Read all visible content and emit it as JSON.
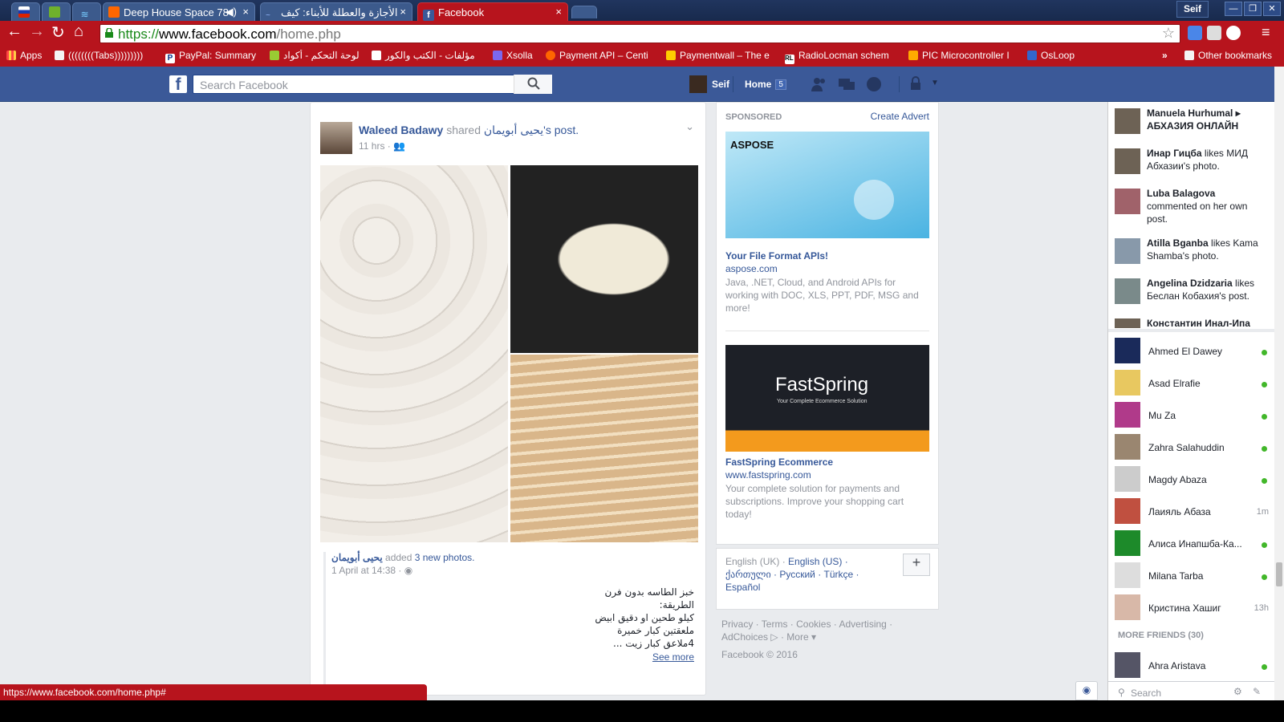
{
  "browser": {
    "tabs": [
      {
        "label": "Deep House Space 78",
        "x": "×"
      },
      {
        "label": "الأجازة والعطلة للأبناء: كيف",
        "x": "×"
      },
      {
        "label": "Facebook",
        "x": "×"
      }
    ],
    "profile": "Seif",
    "url": {
      "scheme": "https://",
      "host": "www.facebook.com",
      "path": "/home.php"
    },
    "bookmarks": [
      "Apps",
      "((((((((Tabs)))))))))",
      "PayPal: Summary",
      "لوحة التحكم - أكواد",
      "مؤلفات - الكتب والكور",
      "Xsolla",
      "Payment API – Centi",
      "Paymentwall – The e",
      "RadioLocman schem",
      "PIC Microcontroller I",
      "OsLoop",
      "»",
      "Other bookmarks"
    ],
    "status_url": "https://www.facebook.com/home.php#"
  },
  "fb_header": {
    "search_placeholder": "Search Facebook",
    "user": "Seif",
    "home": "Home",
    "home_count": "5"
  },
  "post": {
    "author": "Waleed Badawy",
    "shared": "shared",
    "owner": "يحيى أبويمان's",
    "post_word": "post.",
    "time": "11 hrs ·",
    "inner_author": "يحيى أبويمان",
    "inner_added": "added",
    "inner_photos": "3 new photos.",
    "inner_time": "1 April at 14:38 ·",
    "body_lines": [
      "خبز الطاسه بدون فرن",
      "الطريقة:",
      "كيلو طحين او دقيق ابيض",
      "ملعقتين كبار خميرة",
      "4ملاعق كبار زيت ..."
    ],
    "see_more": "See more"
  },
  "ads": {
    "sponsored": "SPONSORED",
    "create": "Create Advert",
    "ad1": {
      "brand": "ASPOSE",
      "title": "Your File Format APIs!",
      "domain": "aspose.com",
      "desc": "Java, .NET, Cloud, and Android APIs for working with DOC, XLS, PPT, PDF, MSG and more!"
    },
    "ad2": {
      "brand": "FastSpring",
      "tagline": "Your Complete Ecommerce Solution",
      "title": "FastSpring Ecommerce",
      "domain": "www.fastspring.com",
      "desc": "Your complete solution for payments and subscriptions. Improve your shopping cart today!"
    }
  },
  "languages": {
    "current": "English (UK) ·",
    "others": [
      "English (US) ·",
      "ქართული ·",
      "Русский ·",
      "Türkçe ·",
      "Español"
    ],
    "plus": "+"
  },
  "footer": {
    "links": "Privacy · Terms · Cookies · Advertising ·",
    "adchoices": "AdChoices",
    "more": "· More ▾",
    "copyright": "Facebook © 2016"
  },
  "ticker": [
    {
      "name": "Manuela Hurhumal",
      "text": "▸ АБХАЗИЯ ОНЛАЙН"
    },
    {
      "name": "Инар Гицба",
      "text": "likes МИД Абхазии's photo."
    },
    {
      "name": "Luba Balagova",
      "text": "commented on her own post."
    },
    {
      "name": "Atilla Bganba",
      "text": "likes Kama Shamba's photo."
    },
    {
      "name": "Angelina Dzidzaria",
      "text": "likes Беслан Кобахия's post."
    },
    {
      "name": "Константин Инал-Ипа",
      "text": ""
    }
  ],
  "chat": {
    "contacts": [
      {
        "name": "Ahmed El Dawey",
        "time": ""
      },
      {
        "name": "Asad Elrafie",
        "time": ""
      },
      {
        "name": "Mu Za",
        "time": ""
      },
      {
        "name": "Zahra Salahuddin",
        "time": ""
      },
      {
        "name": "Magdy Abaza",
        "time": ""
      },
      {
        "name": "Лаияль Абаза",
        "time": "1m"
      },
      {
        "name": "Алиса Инапшба-Ка...",
        "time": ""
      },
      {
        "name": "Milana Tarba",
        "time": ""
      },
      {
        "name": "Кристина Хашиг",
        "time": "13h"
      }
    ],
    "more_friends": "MORE FRIENDS (30)",
    "more_contact": "Ahra Aristava",
    "search": "Search"
  }
}
